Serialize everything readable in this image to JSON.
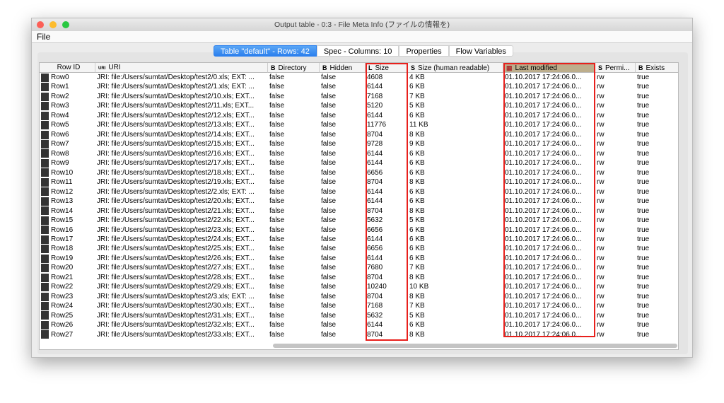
{
  "window": {
    "title": "Output table - 0:3 - File Meta Info (ファイルの情報を)"
  },
  "menu": {
    "file": "File"
  },
  "tabs": [
    "Table \"default\" - Rows: 42",
    "Spec - Columns: 10",
    "Properties",
    "Flow Variables"
  ],
  "columns": [
    {
      "label": "Row ID",
      "type": ""
    },
    {
      "label": "URI",
      "type": "URI"
    },
    {
      "label": "Directory",
      "type": "B"
    },
    {
      "label": "Hidden",
      "type": "B"
    },
    {
      "label": "Size",
      "type": "L"
    },
    {
      "label": "Size (human readable)",
      "type": "S"
    },
    {
      "label": "Last modified",
      "type": "calendar-icon"
    },
    {
      "label": "Permi...",
      "type": "S"
    },
    {
      "label": "Exists",
      "type": "B"
    }
  ],
  "highlight_color": "#e8201c",
  "rows": [
    [
      "Row0",
      "JRI: file:/Users/sumtat/Desktop/test2/0.xls; EXT: ...",
      "false",
      "false",
      "4608",
      "4 KB",
      "01.10.2017 17:24:06.0...",
      "rw",
      "true"
    ],
    [
      "Row1",
      "JRI: file:/Users/sumtat/Desktop/test2/1.xls; EXT: ...",
      "false",
      "false",
      "6144",
      "6 KB",
      "01.10.2017 17:24:06.0...",
      "rw",
      "true"
    ],
    [
      "Row2",
      "JRI: file:/Users/sumtat/Desktop/test2/10.xls; EXT...",
      "false",
      "false",
      "7168",
      "7 KB",
      "01.10.2017 17:24:06.0...",
      "rw",
      "true"
    ],
    [
      "Row3",
      "JRI: file:/Users/sumtat/Desktop/test2/11.xls; EXT...",
      "false",
      "false",
      "5120",
      "5 KB",
      "01.10.2017 17:24:06.0...",
      "rw",
      "true"
    ],
    [
      "Row4",
      "JRI: file:/Users/sumtat/Desktop/test2/12.xls; EXT...",
      "false",
      "false",
      "6144",
      "6 KB",
      "01.10.2017 17:24:06.0...",
      "rw",
      "true"
    ],
    [
      "Row5",
      "JRI: file:/Users/sumtat/Desktop/test2/13.xls; EXT...",
      "false",
      "false",
      "11776",
      "11 KB",
      "01.10.2017 17:24:06.0...",
      "rw",
      "true"
    ],
    [
      "Row6",
      "JRI: file:/Users/sumtat/Desktop/test2/14.xls; EXT...",
      "false",
      "false",
      "8704",
      "8 KB",
      "01.10.2017 17:24:06.0...",
      "rw",
      "true"
    ],
    [
      "Row7",
      "JRI: file:/Users/sumtat/Desktop/test2/15.xls; EXT...",
      "false",
      "false",
      "9728",
      "9 KB",
      "01.10.2017 17:24:06.0...",
      "rw",
      "true"
    ],
    [
      "Row8",
      "JRI: file:/Users/sumtat/Desktop/test2/16.xls; EXT...",
      "false",
      "false",
      "6144",
      "6 KB",
      "01.10.2017 17:24:06.0...",
      "rw",
      "true"
    ],
    [
      "Row9",
      "JRI: file:/Users/sumtat/Desktop/test2/17.xls; EXT...",
      "false",
      "false",
      "6144",
      "6 KB",
      "01.10.2017 17:24:06.0...",
      "rw",
      "true"
    ],
    [
      "Row10",
      "JRI: file:/Users/sumtat/Desktop/test2/18.xls; EXT...",
      "false",
      "false",
      "6656",
      "6 KB",
      "01.10.2017 17:24:06.0...",
      "rw",
      "true"
    ],
    [
      "Row11",
      "JRI: file:/Users/sumtat/Desktop/test2/19.xls; EXT...",
      "false",
      "false",
      "8704",
      "8 KB",
      "01.10.2017 17:24:06.0...",
      "rw",
      "true"
    ],
    [
      "Row12",
      "JRI: file:/Users/sumtat/Desktop/test2/2.xls; EXT: ...",
      "false",
      "false",
      "6144",
      "6 KB",
      "01.10.2017 17:24:06.0...",
      "rw",
      "true"
    ],
    [
      "Row13",
      "JRI: file:/Users/sumtat/Desktop/test2/20.xls; EXT...",
      "false",
      "false",
      "6144",
      "6 KB",
      "01.10.2017 17:24:06.0...",
      "rw",
      "true"
    ],
    [
      "Row14",
      "JRI: file:/Users/sumtat/Desktop/test2/21.xls; EXT...",
      "false",
      "false",
      "8704",
      "8 KB",
      "01.10.2017 17:24:06.0...",
      "rw",
      "true"
    ],
    [
      "Row15",
      "JRI: file:/Users/sumtat/Desktop/test2/22.xls; EXT...",
      "false",
      "false",
      "5632",
      "5 KB",
      "01.10.2017 17:24:06.0...",
      "rw",
      "true"
    ],
    [
      "Row16",
      "JRI: file:/Users/sumtat/Desktop/test2/23.xls; EXT...",
      "false",
      "false",
      "6656",
      "6 KB",
      "01.10.2017 17:24:06.0...",
      "rw",
      "true"
    ],
    [
      "Row17",
      "JRI: file:/Users/sumtat/Desktop/test2/24.xls; EXT...",
      "false",
      "false",
      "6144",
      "6 KB",
      "01.10.2017 17:24:06.0...",
      "rw",
      "true"
    ],
    [
      "Row18",
      "JRI: file:/Users/sumtat/Desktop/test2/25.xls; EXT...",
      "false",
      "false",
      "6656",
      "6 KB",
      "01.10.2017 17:24:06.0...",
      "rw",
      "true"
    ],
    [
      "Row19",
      "JRI: file:/Users/sumtat/Desktop/test2/26.xls; EXT...",
      "false",
      "false",
      "6144",
      "6 KB",
      "01.10.2017 17:24:06.0...",
      "rw",
      "true"
    ],
    [
      "Row20",
      "JRI: file:/Users/sumtat/Desktop/test2/27.xls; EXT...",
      "false",
      "false",
      "7680",
      "7 KB",
      "01.10.2017 17:24:06.0...",
      "rw",
      "true"
    ],
    [
      "Row21",
      "JRI: file:/Users/sumtat/Desktop/test2/28.xls; EXT...",
      "false",
      "false",
      "8704",
      "8 KB",
      "01.10.2017 17:24:06.0...",
      "rw",
      "true"
    ],
    [
      "Row22",
      "JRI: file:/Users/sumtat/Desktop/test2/29.xls; EXT...",
      "false",
      "false",
      "10240",
      "10 KB",
      "01.10.2017 17:24:06.0...",
      "rw",
      "true"
    ],
    [
      "Row23",
      "JRI: file:/Users/sumtat/Desktop/test2/3.xls; EXT: ...",
      "false",
      "false",
      "8704",
      "8 KB",
      "01.10.2017 17:24:06.0...",
      "rw",
      "true"
    ],
    [
      "Row24",
      "JRI: file:/Users/sumtat/Desktop/test2/30.xls; EXT...",
      "false",
      "false",
      "7168",
      "7 KB",
      "01.10.2017 17:24:06.0...",
      "rw",
      "true"
    ],
    [
      "Row25",
      "JRI: file:/Users/sumtat/Desktop/test2/31.xls; EXT...",
      "false",
      "false",
      "5632",
      "5 KB",
      "01.10.2017 17:24:06.0...",
      "rw",
      "true"
    ],
    [
      "Row26",
      "JRI: file:/Users/sumtat/Desktop/test2/32.xls; EXT...",
      "false",
      "false",
      "6144",
      "6 KB",
      "01.10.2017 17:24:06.0...",
      "rw",
      "true"
    ],
    [
      "Row27",
      "JRI: file:/Users/sumtat/Desktop/test2/33.xls; EXT...",
      "false",
      "false",
      "8704",
      "8 KB",
      "01.10.2017 17:24:06.0...",
      "rw",
      "true"
    ]
  ]
}
